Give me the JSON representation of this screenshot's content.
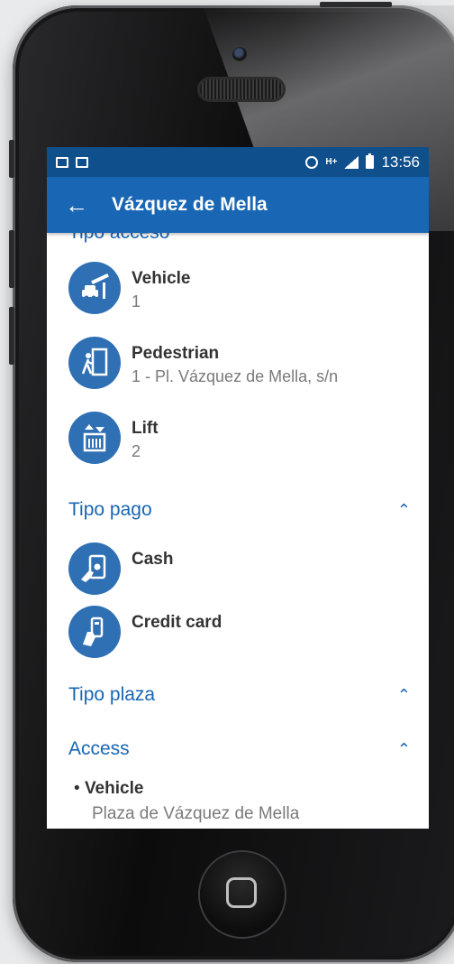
{
  "statusbar": {
    "time": "13:56",
    "network": "H+"
  },
  "appbar": {
    "title": "Vázquez de Mella"
  },
  "access_types": {
    "heading": "Tipo acceso",
    "items": [
      {
        "title": "Vehicle",
        "subtitle": "1",
        "icon": "car-barrier-icon"
      },
      {
        "title": "Pedestrian",
        "subtitle": "1 - Pl. Vázquez de Mella, s/n",
        "icon": "pedestrian-door-icon"
      },
      {
        "title": "Lift",
        "subtitle": "2",
        "icon": "elevator-icon"
      }
    ]
  },
  "payment": {
    "heading": "Tipo pago",
    "items": [
      {
        "title": "Cash",
        "icon": "cash-icon"
      },
      {
        "title": "Credit card",
        "icon": "credit-card-icon"
      }
    ]
  },
  "space_type": {
    "heading": "Tipo plaza"
  },
  "access": {
    "heading": "Access",
    "entries": [
      {
        "bullet": "•",
        "title": "Vehicle",
        "subtitle": "Plaza de Vázquez de Mella"
      }
    ]
  },
  "colors": {
    "statusbar": "#0f4f8c",
    "appbar": "#1866b4",
    "icon_circle": "#2f70b5",
    "accent": "#1866b4"
  }
}
